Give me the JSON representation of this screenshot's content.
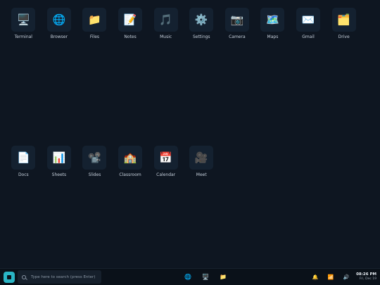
{
  "desktop": {
    "row1": [
      {
        "label": "Terminal",
        "icon": "🖥️",
        "icon_name": "terminal-icon"
      },
      {
        "label": "Browser",
        "icon": "🌐",
        "icon_name": "globe-icon"
      },
      {
        "label": "Files",
        "icon": "📁",
        "icon_name": "folder-icon"
      },
      {
        "label": "Notes",
        "icon": "📝",
        "icon_name": "notepad-icon"
      },
      {
        "label": "Music",
        "icon": "🎵",
        "icon_name": "music-note-icon"
      },
      {
        "label": "Settings",
        "icon": "⚙️",
        "icon_name": "gear-icon"
      },
      {
        "label": "Camera",
        "icon": "📷",
        "icon_name": "camera-icon"
      },
      {
        "label": "Maps",
        "icon": "🗺️",
        "icon_name": "map-icon"
      },
      {
        "label": "Gmail",
        "icon": "✉️",
        "icon_name": "envelope-icon"
      },
      {
        "label": "Drive",
        "icon": "🗂️",
        "icon_name": "drive-folder-icon"
      }
    ],
    "row2": [
      {
        "label": "Docs",
        "icon": "📄",
        "icon_name": "document-icon"
      },
      {
        "label": "Sheets",
        "icon": "📊",
        "icon_name": "spreadsheet-icon"
      },
      {
        "label": "Slides",
        "icon": "📽️",
        "icon_name": "projector-icon"
      },
      {
        "label": "Classroom",
        "icon": "🏫",
        "icon_name": "school-icon"
      },
      {
        "label": "Calendar",
        "icon": "📅",
        "icon_name": "calendar-icon"
      },
      {
        "label": "Meet",
        "icon": "🎥",
        "icon_name": "video-camera-icon"
      }
    ]
  },
  "taskbar": {
    "search": {
      "placeholder": "Type here to search (press Enter)",
      "value": ""
    },
    "pinned": [
      {
        "icon": "🌐",
        "icon_name": "globe-icon"
      },
      {
        "icon": "🖥️",
        "icon_name": "terminal-icon"
      },
      {
        "icon": "📁",
        "icon_name": "folder-icon"
      }
    ],
    "tray": [
      {
        "icon": "🔔",
        "icon_name": "bell-icon"
      },
      {
        "icon": "📶",
        "icon_name": "wifi-signal-icon"
      },
      {
        "icon": "🔊",
        "icon_name": "speaker-icon"
      }
    ],
    "clock": {
      "time": "08:26 PM",
      "date": "Fri, Dec 19"
    }
  },
  "colors": {
    "desktop_bg": "#0e1621",
    "tile_bg": "#142130",
    "taskbar_bg": "#0a1119",
    "start_accent": "#2ab5c5"
  }
}
